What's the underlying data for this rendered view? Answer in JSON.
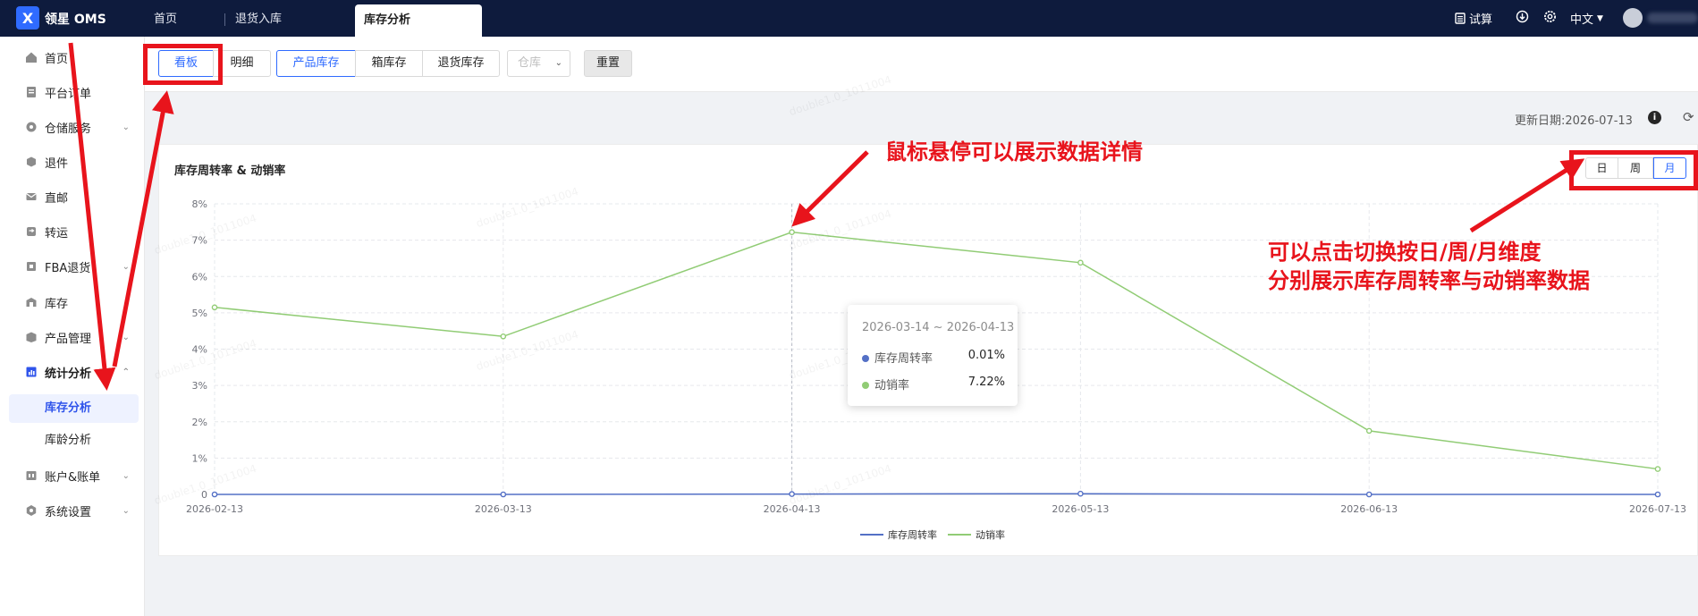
{
  "app": {
    "brand": "领星 OMS",
    "logo_glyph": "X"
  },
  "top_tabs": [
    {
      "label": "首页"
    },
    {
      "label": "退货入库"
    },
    {
      "label": "库存分析"
    }
  ],
  "top_right": {
    "trial": "试算",
    "language": "中文"
  },
  "sidebar": {
    "items": [
      {
        "label": "首页",
        "icon": "home-icon"
      },
      {
        "label": "平台订单",
        "icon": "order-icon"
      },
      {
        "label": "仓储服务",
        "icon": "warehouse-icon"
      },
      {
        "label": "退件",
        "icon": "return-icon"
      },
      {
        "label": "直邮",
        "icon": "mail-icon"
      },
      {
        "label": "转运",
        "icon": "transfer-icon"
      },
      {
        "label": "FBA退货",
        "icon": "fba-icon"
      },
      {
        "label": "库存",
        "icon": "inventory-icon"
      },
      {
        "label": "产品管理",
        "icon": "product-icon"
      },
      {
        "label": "统计分析",
        "icon": "stats-icon"
      },
      {
        "label": "账户&账单",
        "icon": "account-icon"
      },
      {
        "label": "系统设置",
        "icon": "settings-icon"
      }
    ],
    "sub_items": [
      {
        "label": "库存分析"
      },
      {
        "label": "库龄分析"
      }
    ]
  },
  "toolbar": {
    "view_board": "看板",
    "view_detail": "明细",
    "tab_product": "产品库存",
    "tab_box": "箱库存",
    "tab_return": "退货库存",
    "warehouse_placeholder": "仓库",
    "reset": "重置"
  },
  "updated": "更新日期:2026-07-13",
  "card": {
    "title": "库存周转率 & 动销率",
    "granularity": [
      "日",
      "周",
      "月"
    ],
    "selected_granularity": "月"
  },
  "chart_data": {
    "type": "line",
    "title": "库存周转率 & 动销率",
    "x": [
      "2026-02-13",
      "2026-03-13",
      "2026-04-13",
      "2026-05-13",
      "2026-06-13",
      "2026-07-13"
    ],
    "y_ticks": [
      "0",
      "1%",
      "2%",
      "3%",
      "4%",
      "5%",
      "6%",
      "7%",
      "8%"
    ],
    "ylim": [
      0,
      8
    ],
    "grid": true,
    "legend_position": "bottom-center",
    "series": [
      {
        "name": "库存周转率",
        "color": "#5470c6",
        "values": [
          0.0,
          0.0,
          0.01,
          0.02,
          0.0,
          0.0
        ]
      },
      {
        "name": "动销率",
        "color": "#91cc75",
        "values": [
          5.15,
          4.35,
          7.22,
          6.38,
          1.75,
          0.7
        ]
      }
    ]
  },
  "tooltip": {
    "title": "2026-03-14 ~ 2026-04-13",
    "rows": [
      {
        "name": "库存周转率",
        "value": "0.01%",
        "color": "#5470c6"
      },
      {
        "name": "动销率",
        "value": "7.22%",
        "color": "#91cc75"
      }
    ]
  },
  "annotations": {
    "hover_note": "鼠标悬停可以展示数据详情",
    "switch_note_line1": "可以点击切换按日/周/月维度",
    "switch_note_line2": "分别展示库存周转率与动销率数据",
    "color": "#e8141c"
  },
  "watermark": "double1.0_1011004"
}
